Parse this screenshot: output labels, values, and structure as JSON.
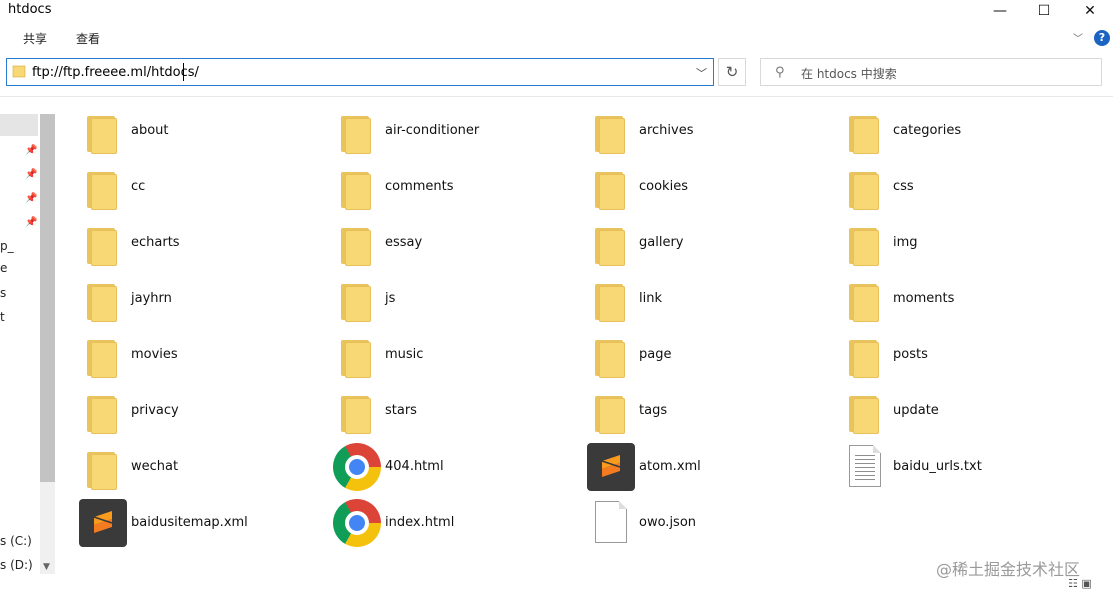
{
  "window": {
    "title": "htdocs",
    "minimize_icon": "minimize-icon",
    "maximize_icon": "maximize-icon",
    "close_icon": "close-icon"
  },
  "ribbon": {
    "tabs": [
      "共享",
      "查看"
    ],
    "help_label": "?"
  },
  "address": {
    "path": "ftp://ftp.freeee.ml/htdocs/",
    "refresh_icon": "refresh-icon"
  },
  "search": {
    "placeholder": "在 htdocs 中搜索"
  },
  "nav": {
    "drives": [
      "s (C:)",
      "s (D:)"
    ],
    "fragments": [
      "p_",
      "e",
      "s",
      "t"
    ]
  },
  "items": [
    {
      "name": "about",
      "type": "folder"
    },
    {
      "name": "air-conditioner",
      "type": "folder"
    },
    {
      "name": "archives",
      "type": "folder"
    },
    {
      "name": "categories",
      "type": "folder"
    },
    {
      "name": "cc",
      "type": "folder"
    },
    {
      "name": "comments",
      "type": "folder"
    },
    {
      "name": "cookies",
      "type": "folder"
    },
    {
      "name": "css",
      "type": "folder"
    },
    {
      "name": "echarts",
      "type": "folder"
    },
    {
      "name": "essay",
      "type": "folder"
    },
    {
      "name": "gallery",
      "type": "folder"
    },
    {
      "name": "img",
      "type": "folder"
    },
    {
      "name": "jayhrn",
      "type": "folder"
    },
    {
      "name": "js",
      "type": "folder"
    },
    {
      "name": "link",
      "type": "folder"
    },
    {
      "name": "moments",
      "type": "folder"
    },
    {
      "name": "movies",
      "type": "folder"
    },
    {
      "name": "music",
      "type": "folder"
    },
    {
      "name": "page",
      "type": "folder"
    },
    {
      "name": "posts",
      "type": "folder"
    },
    {
      "name": "privacy",
      "type": "folder"
    },
    {
      "name": "stars",
      "type": "folder"
    },
    {
      "name": "tags",
      "type": "folder"
    },
    {
      "name": "update",
      "type": "folder"
    },
    {
      "name": "wechat",
      "type": "folder"
    },
    {
      "name": "404.html",
      "type": "chrome"
    },
    {
      "name": "atom.xml",
      "type": "sublime"
    },
    {
      "name": "baidu_urls.txt",
      "type": "text"
    },
    {
      "name": "baidusitemap.xml",
      "type": "sublime"
    },
    {
      "name": "index.html",
      "type": "chrome"
    },
    {
      "name": "owo.json",
      "type": "blank"
    }
  ],
  "watermark": "@稀土掘金技术社区",
  "colors": {
    "accent": "#2a7bd4",
    "folder": "#f8d775",
    "help": "#1c64c2"
  }
}
